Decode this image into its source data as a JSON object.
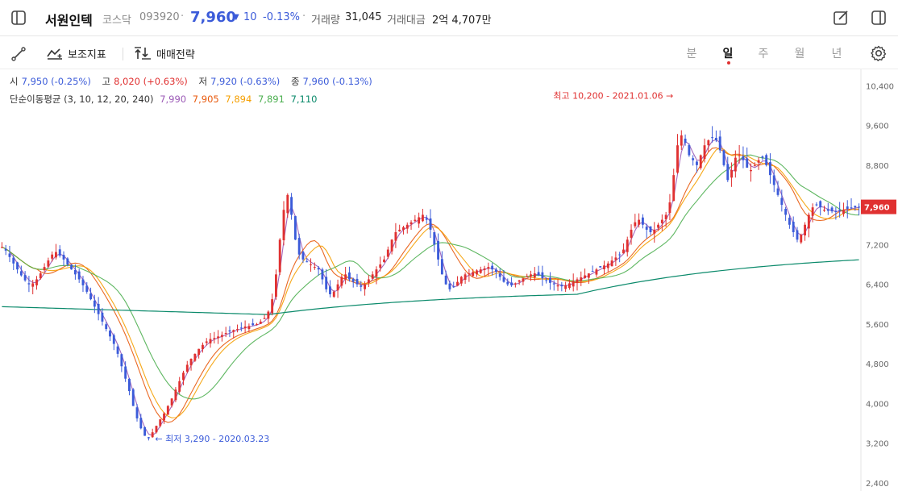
{
  "header": {
    "stock_name": "서원인텍",
    "market": "코스닥",
    "code": "093920",
    "price": "7,960",
    "change_arrow": "▼",
    "change": "10",
    "change_pct": "-0.13%",
    "volume_label": "거래량",
    "volume": "31,045",
    "amount_label": "거래대금",
    "amount": "2억 4,707만"
  },
  "toolbar": {
    "indicator_label": "보조지표",
    "strategy_label": "매매전략",
    "periods": [
      "분",
      "일",
      "주",
      "월",
      "년"
    ],
    "active_period": "일"
  },
  "ohlc": {
    "open_label": "시",
    "open": "7,950 (-0.25%)",
    "high_label": "고",
    "high": "8,020 (+0.63%)",
    "low_label": "저",
    "low": "7,920 (-0.63%)",
    "close_label": "종",
    "close": "7,960 (-0.13%)"
  },
  "ma": {
    "label": "단순이동평균 (3, 10, 12, 20, 240)",
    "values": [
      "7,990",
      "7,905",
      "7,894",
      "7,891",
      "7,110"
    ],
    "colors": [
      "#9b59b6",
      "#e8590c",
      "#f59f00",
      "#4caf50",
      "#0b8a6b"
    ]
  },
  "colors": {
    "up": "#e03131",
    "down": "#3b5bd9",
    "grid": "#f0f0f0"
  },
  "chart_data": {
    "type": "candlestick",
    "ylim": [
      2400,
      10600
    ],
    "y_ticks": [
      "2,400",
      "3,200",
      "4,000",
      "4,800",
      "5,600",
      "6,400",
      "7,200",
      "8,000",
      "8,800",
      "9,600",
      "10,400"
    ],
    "y_tick_values": [
      2400,
      3200,
      4000,
      4800,
      5600,
      6400,
      7200,
      8000,
      8800,
      9600,
      10400
    ],
    "current_price": 7960,
    "current_price_label": "7,960",
    "max_annotation": "최고 10,200 - 2021.01.06",
    "min_annotation": "최저 3,290 - 2020.03.23",
    "max_value": 10200,
    "min_value": 3290,
    "close_series": [
      7150,
      7080,
      6950,
      6820,
      6700,
      6580,
      6480,
      6400,
      6420,
      6500,
      6620,
      6750,
      6880,
      7000,
      7050,
      6980,
      6900,
      6800,
      6700,
      6600,
      6500,
      6380,
      6250,
      6100,
      5950,
      5800,
      5650,
      5500,
      5350,
      5200,
      5000,
      4750,
      4500,
      4250,
      3950,
      3700,
      3500,
      3350,
      3300,
      3420,
      3550,
      3680,
      3800,
      3950,
      4100,
      4280,
      4450,
      4620,
      4780,
      4900,
      5000,
      5100,
      5180,
      5250,
      5300,
      5320,
      5350,
      5380,
      5420,
      5450,
      5480,
      5500,
      5520,
      5550,
      5560,
      5580,
      5600,
      5650,
      5720,
      5850,
      6100,
      6600,
      7300,
      7900,
      8200,
      7800,
      7300,
      7000,
      6900,
      6850,
      6800,
      6750,
      6700,
      6500,
      6300,
      6200,
      6250,
      6400,
      6550,
      6600,
      6500,
      6450,
      6400,
      6350,
      6400,
      6500,
      6600,
      6700,
      6800,
      6900,
      7100,
      7300,
      7450,
      7500,
      7550,
      7600,
      7650,
      7700,
      7750,
      7800,
      7700,
      7500,
      7200,
      6900,
      6600,
      6400,
      6300,
      6350,
      6450,
      6550,
      6600,
      6620,
      6650,
      6680,
      6700,
      6720,
      6750,
      6700,
      6650,
      6550,
      6450,
      6400,
      6380,
      6420,
      6480,
      6520,
      6560,
      6600,
      6620,
      6580,
      6520,
      6480,
      6430,
      6400,
      6380,
      6360,
      6380,
      6420,
      6460,
      6500,
      6540,
      6580,
      6620,
      6660,
      6700,
      6740,
      6780,
      6820,
      6880,
      6940,
      7000,
      7100,
      7300,
      7500,
      7650,
      7700,
      7600,
      7500,
      7450,
      7500,
      7600,
      7700,
      7800,
      8050,
      8600,
      9200,
      9400,
      9250,
      9000,
      8900,
      8800,
      9000,
      9200,
      9300,
      9350,
      9300,
      9100,
      8800,
      8500,
      8700,
      8950,
      9000,
      8900,
      8750,
      8700,
      8800,
      8900,
      8950,
      8800,
      8600,
      8400,
      8200,
      8000,
      7800,
      7600,
      7450,
      7300,
      7400,
      7600,
      7800,
      7950,
      8000,
      7950,
      7900,
      7880,
      7870,
      7860,
      7880,
      7900,
      7920,
      7940,
      7950,
      7960
    ]
  }
}
